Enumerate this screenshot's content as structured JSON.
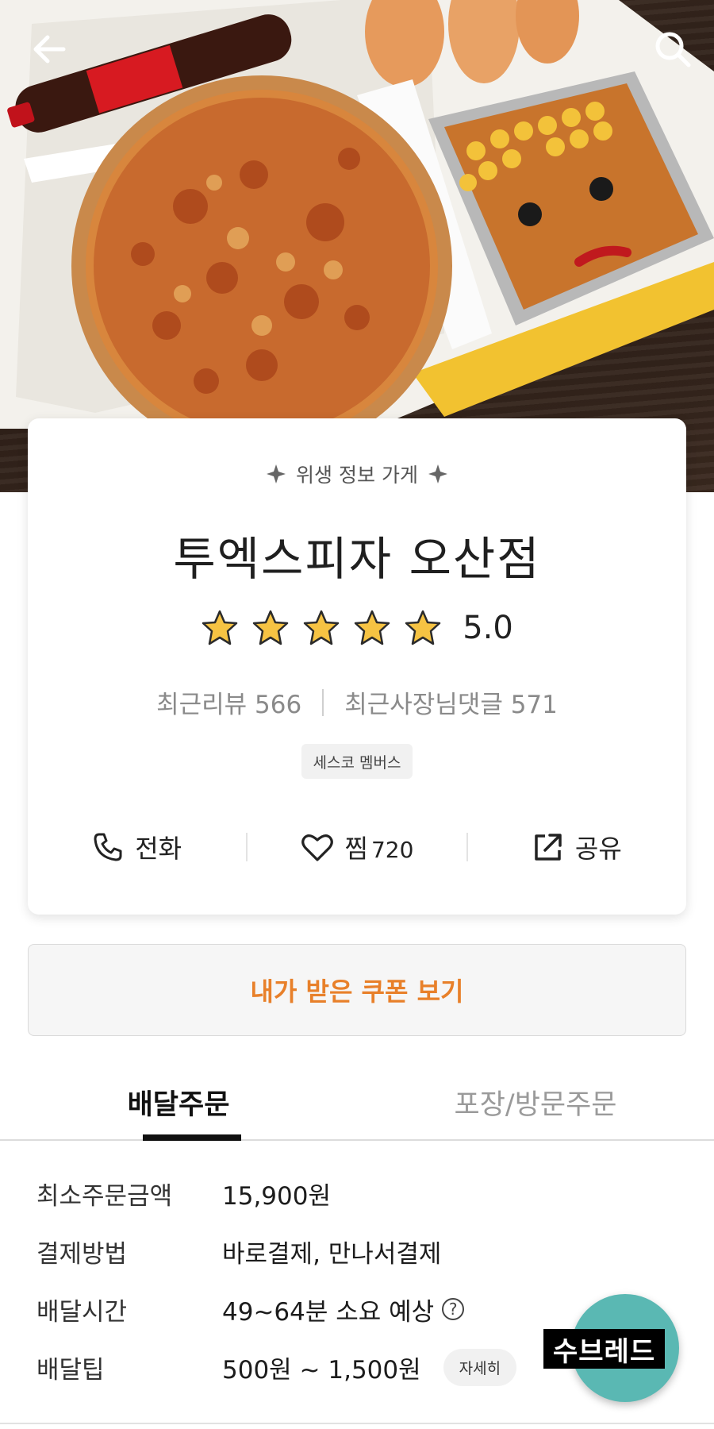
{
  "header": {
    "back_icon": "arrow-left-icon",
    "search_icon": "search-icon"
  },
  "store": {
    "hygiene_badge": "위생 정보 가게",
    "name": "투엑스피자 오산점",
    "rating": 5,
    "rating_text": "5.0",
    "recent_reviews_text": "최근리뷰 566",
    "recent_owner_replies_text": "최근사장님댓글 571",
    "member_badge": "세스코 멤버스"
  },
  "actions": {
    "call_label": "전화",
    "wish_label": "찜",
    "wish_count": "720",
    "share_label": "공유"
  },
  "coupon": {
    "label": "내가 받은 쿠폰 보기"
  },
  "tabs": [
    {
      "label": "배달주문",
      "active": true
    },
    {
      "label": "포장/방문주문",
      "active": false
    }
  ],
  "info": {
    "min_order": {
      "label": "최소주문금액",
      "value": "15,900원"
    },
    "payment": {
      "label": "결제방법",
      "value": "바로결제, 만나서결제"
    },
    "delivery_time": {
      "label": "배달시간",
      "value": "49~64분 소요 예상"
    },
    "delivery_tip": {
      "label": "배달팁",
      "value": "500원 ~ 1,500원",
      "detail_label": "자세히"
    }
  },
  "fab": {
    "label": "수브레드"
  },
  "colors": {
    "accent": "#e8802a",
    "star": "#f6c343",
    "fab": "#5ab8b3"
  }
}
